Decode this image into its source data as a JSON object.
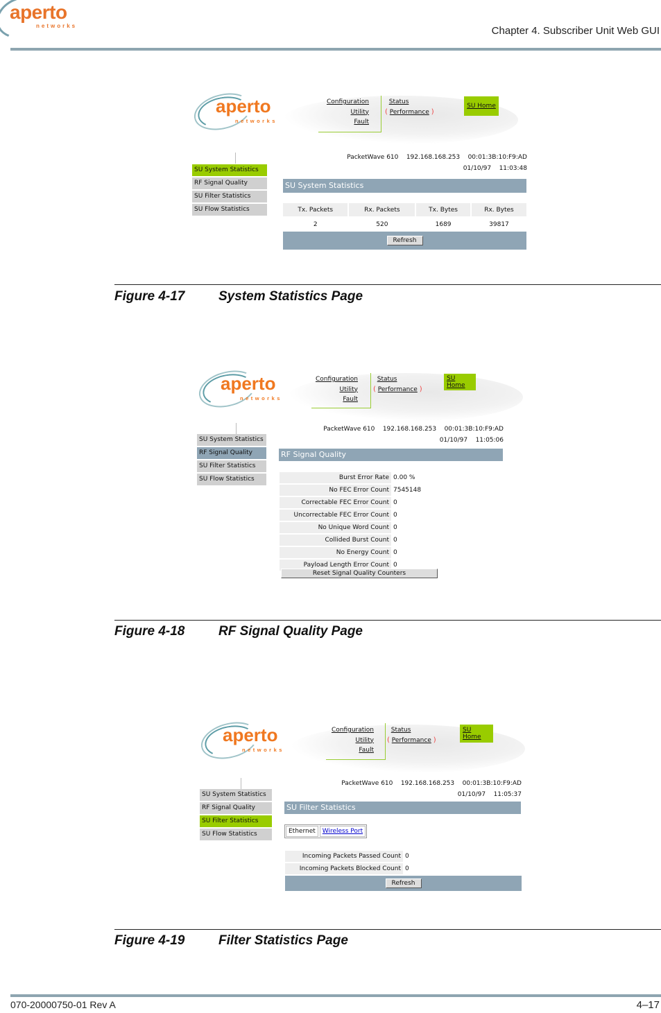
{
  "doc": {
    "logo": {
      "word": "aperto",
      "sub": "networks"
    },
    "chapter": "Chapter 4.  Subscriber Unit Web GUI",
    "footer_left": "070-20000750-01 Rev A",
    "footer_right": "4–17"
  },
  "common": {
    "nav_left": [
      "Configuration",
      "Utility",
      "Fault"
    ],
    "nav_right": [
      "Status",
      "Performance"
    ],
    "su_home": "SU Home",
    "device": "PacketWave 610",
    "ip": "192.168.168.253",
    "mac": "00:01:3B:10:F9:AD",
    "date": "01/10/97",
    "sidebar": [
      "SU System Statistics",
      "RF Signal Quality",
      "SU Filter Statistics",
      "SU Flow Statistics"
    ],
    "colors": {
      "accent_green": "#99cc00",
      "header_blue": "#8fa5b5",
      "logo_orange": "#f07820"
    }
  },
  "figures": [
    {
      "number": "Figure 4-17",
      "title": "System Statistics Page",
      "time": "11:03:48",
      "page_title": "SU System Statistics",
      "table": {
        "headers": [
          "Tx. Packets",
          "Rx. Packets",
          "Tx. Bytes",
          "Rx. Bytes"
        ],
        "values": [
          "2",
          "520",
          "1689",
          "39817"
        ]
      },
      "button": "Refresh"
    },
    {
      "number": "Figure 4-18",
      "title": "RF Signal Quality Page",
      "time": "11:05:06",
      "page_title": "RF Signal Quality",
      "rows": [
        {
          "label": "Burst Error Rate",
          "value": "0.00 %"
        },
        {
          "label": "No FEC Error Count",
          "value": "7545148"
        },
        {
          "label": "Correctable FEC Error Count",
          "value": "0"
        },
        {
          "label": "Uncorrectable FEC Error Count",
          "value": "0"
        },
        {
          "label": "No Unique Word Count",
          "value": "0"
        },
        {
          "label": "Collided Burst Count",
          "value": "0"
        },
        {
          "label": "No Energy Count",
          "value": "0"
        },
        {
          "label": "Payload Length Error Count",
          "value": "0"
        }
      ],
      "button": "Reset Signal Quality Counters"
    },
    {
      "number": "Figure 4-19",
      "title": "Filter Statistics Page",
      "time": "11:05:37",
      "page_title": "SU Filter Statistics",
      "tabs": [
        "Ethernet",
        "Wireless Port"
      ],
      "rows": [
        {
          "label": "Incoming Packets Passed Count",
          "value": "0"
        },
        {
          "label": "Incoming Packets Blocked Count",
          "value": "0"
        }
      ],
      "button": "Refresh"
    }
  ]
}
